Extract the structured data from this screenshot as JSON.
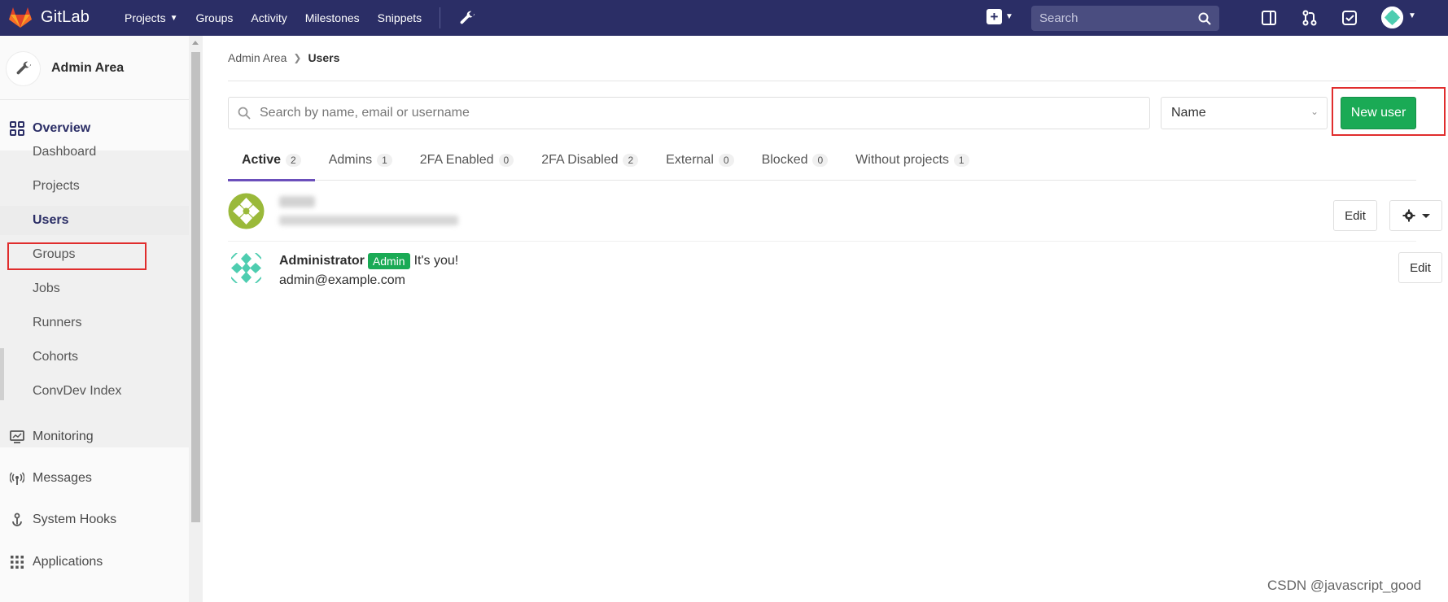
{
  "navbar": {
    "brand": "GitLab",
    "links": [
      {
        "label": "Projects",
        "has_dropdown": true
      },
      {
        "label": "Groups"
      },
      {
        "label": "Activity"
      },
      {
        "label": "Milestones"
      },
      {
        "label": "Snippets"
      }
    ],
    "search_placeholder": "Search",
    "colors": {
      "background": "#2b2e66",
      "logo_orange": "#e2432a"
    }
  },
  "sidebar": {
    "title": "Admin Area",
    "overview_label": "Overview",
    "sub_items": [
      "Dashboard",
      "Projects",
      "Users",
      "Groups",
      "Jobs",
      "Runners",
      "Cohorts",
      "ConvDev Index"
    ],
    "active_item": "Users",
    "sections": [
      {
        "label": "Monitoring",
        "icon": "monitor-icon"
      },
      {
        "label": "Messages",
        "icon": "broadcast-icon"
      },
      {
        "label": "System Hooks",
        "icon": "hook-icon"
      },
      {
        "label": "Applications",
        "icon": "apps-grid-icon"
      }
    ]
  },
  "breadcrumb": {
    "parent": "Admin Area",
    "current": "Users"
  },
  "filters": {
    "search_placeholder": "Search by name, email or username",
    "sort_value": "Name",
    "new_user_label": "New user"
  },
  "tabs": [
    {
      "label": "Active",
      "count": "2",
      "active": true
    },
    {
      "label": "Admins",
      "count": "1"
    },
    {
      "label": "2FA Enabled",
      "count": "0"
    },
    {
      "label": "2FA Disabled",
      "count": "2"
    },
    {
      "label": "External",
      "count": "0"
    },
    {
      "label": "Blocked",
      "count": "0"
    },
    {
      "label": "Without projects",
      "count": "1"
    }
  ],
  "users": [
    {
      "name": "",
      "email": "",
      "redacted": true,
      "edit_label": "Edit"
    },
    {
      "name": "Administrator",
      "badge": "Admin",
      "note": "It's you!",
      "email": "admin@example.com",
      "edit_label": "Edit"
    }
  ],
  "watermark": "CSDN @javascript_good",
  "colors": {
    "accent": "#1aaa55",
    "tab_active": "#6b4fbb",
    "highlight_box": "#e02d2d"
  }
}
